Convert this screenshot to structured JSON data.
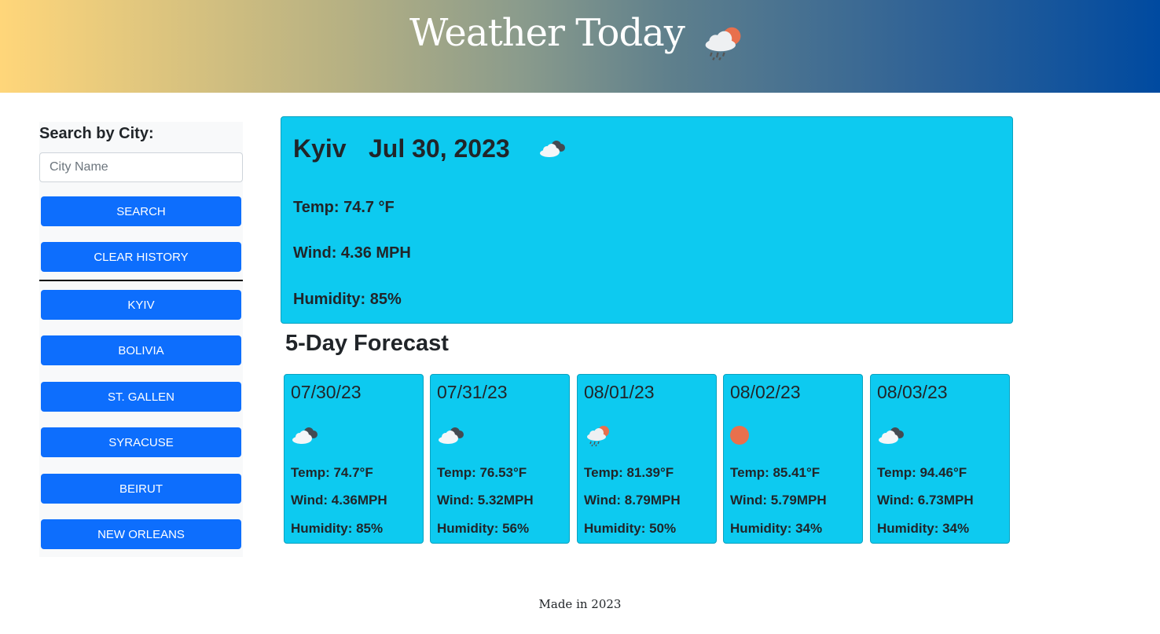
{
  "header": {
    "title": "Weather Today",
    "icon": "cloud-rain-sun-icon"
  },
  "sidebar": {
    "label": "Search by City:",
    "input_placeholder": "City Name",
    "input_value": "",
    "search_button": "SEARCH",
    "clear_button": "CLEAR HISTORY",
    "history": [
      "KYIV",
      "BOLIVIA",
      "ST. GALLEN",
      "SYRACUSE",
      "BEIRUT",
      "NEW ORLEANS"
    ]
  },
  "current": {
    "city": "Kyiv",
    "date": "Jul 30, 2023",
    "icon": "cloud-icon",
    "temp": "Temp: 74.7 °F",
    "wind": "Wind: 4.36 MPH",
    "humidity": "Humidity: 85%"
  },
  "forecast": {
    "title": "5-Day Forecast",
    "days": [
      {
        "date": "07/30/23",
        "icon": "cloud-icon",
        "temp": "Temp: 74.7°F",
        "wind": "Wind: 4.36MPH",
        "humidity": "Humidity: 85%"
      },
      {
        "date": "07/31/23",
        "icon": "cloud-icon",
        "temp": "Temp: 76.53°F",
        "wind": "Wind: 5.32MPH",
        "humidity": "Humidity: 56%"
      },
      {
        "date": "08/01/23",
        "icon": "cloud-rain-sun-icon",
        "temp": "Temp: 81.39°F",
        "wind": "Wind: 8.79MPH",
        "humidity": "Humidity: 50%"
      },
      {
        "date": "08/02/23",
        "icon": "sun-icon",
        "temp": "Temp: 85.41°F",
        "wind": "Wind: 5.79MPH",
        "humidity": "Humidity: 34%"
      },
      {
        "date": "08/03/23",
        "icon": "cloud-icon",
        "temp": "Temp: 94.46°F",
        "wind": "Wind: 6.73MPH",
        "humidity": "Humidity: 34%"
      }
    ]
  },
  "footer": {
    "text": "Made in 2023"
  },
  "colors": {
    "card": "#0dcaf0",
    "button": "#0d6efd",
    "sun": "#e8704d"
  }
}
